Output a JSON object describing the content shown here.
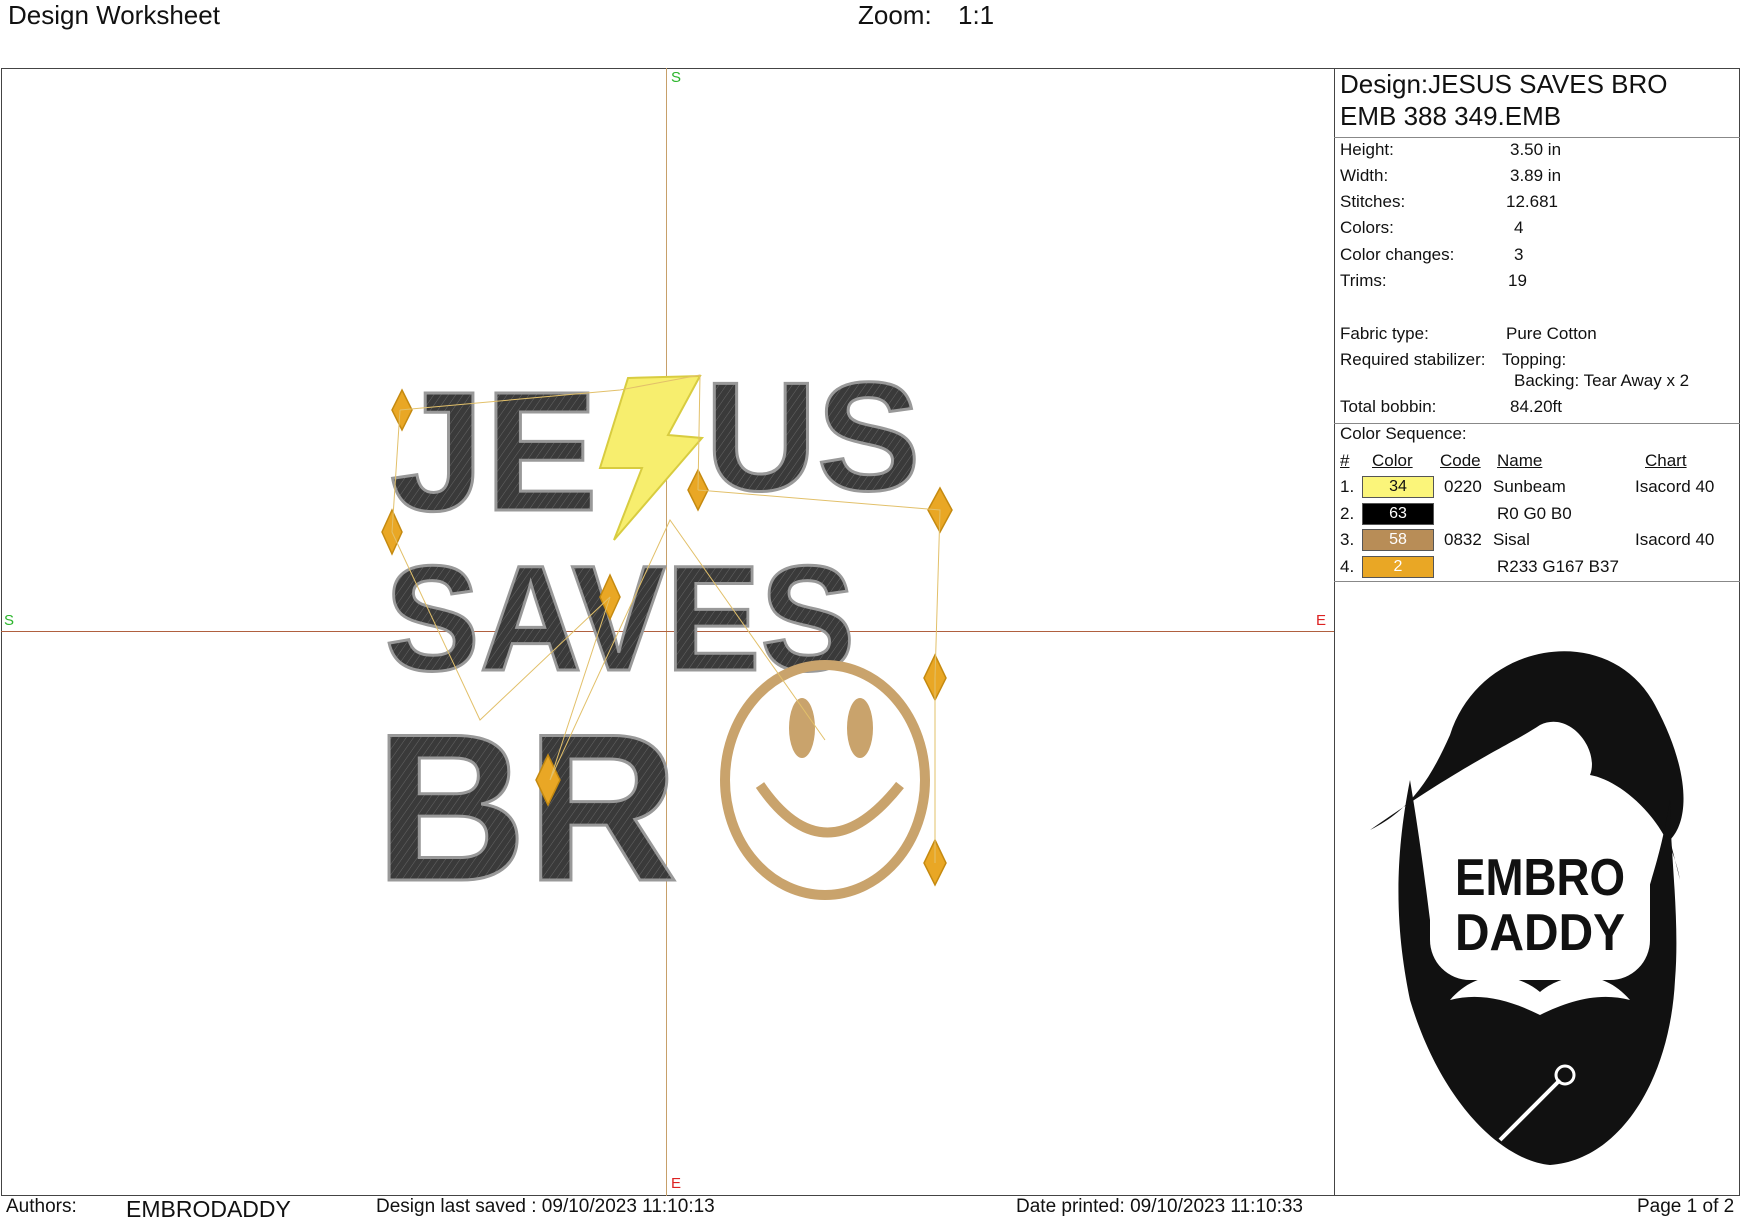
{
  "header": {
    "title": "Design Worksheet",
    "zoom_label": "Zoom:",
    "zoom_value": "1:1"
  },
  "canvas": {
    "axis_labels": {
      "top": "S",
      "left": "S",
      "right": "E",
      "bottom": "E"
    },
    "design_words": [
      "JE",
      "US",
      "SAVES",
      "BR"
    ],
    "colors": {
      "fill": "#3a3a3a",
      "bolt": "#f7ee6e",
      "smiley": "#c9a36c",
      "star": "#e9a725",
      "jump": "#e2c06a"
    }
  },
  "info": {
    "design_line": "Design:JESUS SAVES BRO",
    "file_line": "EMB 388 349.EMB",
    "rows": [
      {
        "label": "Height:",
        "value": "3.50 in"
      },
      {
        "label": "Width:",
        "value": "3.89 in"
      },
      {
        "label": "Stitches:",
        "value": "12.681"
      },
      {
        "label": "Colors:",
        "value": "4"
      },
      {
        "label": "Color changes:",
        "value": "3"
      },
      {
        "label": "Trims:",
        "value": "19"
      }
    ],
    "fabric_label": "Fabric type:",
    "fabric_value": "Pure Cotton",
    "stabilizer_label": "Required stabilizer:",
    "topping": "Topping:",
    "backing": "Backing: Tear Away x 2",
    "bobbin_label": "Total bobbin:",
    "bobbin_value": "84.20ft"
  },
  "sequence": {
    "title": "Color Sequence:",
    "headers": {
      "num": "#",
      "color": "Color",
      "code": "Code",
      "name": "Name",
      "chart": "Chart"
    },
    "rows": [
      {
        "num": "1.",
        "swatch": "34",
        "bg": "#fbf57a",
        "fg": "#111111",
        "code": "0220",
        "name": "Sunbeam",
        "chart": "Isacord 40"
      },
      {
        "num": "2.",
        "swatch": "63",
        "bg": "#000000",
        "fg": "#ffffff",
        "code": "",
        "name": "R0 G0 B0",
        "chart": ""
      },
      {
        "num": "3.",
        "swatch": "58",
        "bg": "#b88d57",
        "fg": "#ffffff",
        "code": "0832",
        "name": "Sisal",
        "chart": "Isacord 40"
      },
      {
        "num": "4.",
        "swatch": "2",
        "bg": "#e9a725",
        "fg": "#ffffff",
        "code": "",
        "name": "R233 G167 B37",
        "chart": ""
      }
    ]
  },
  "logo": {
    "line1": "EMBRO",
    "line2": "DADDY"
  },
  "footer": {
    "authors_label": "Authors:",
    "authors_value": "EMBRODADDY",
    "saved": "Design last saved : 09/10/2023 11:10:13",
    "printed": "Date printed: 09/10/2023 11:10:33",
    "page": "Page 1 of 2"
  }
}
